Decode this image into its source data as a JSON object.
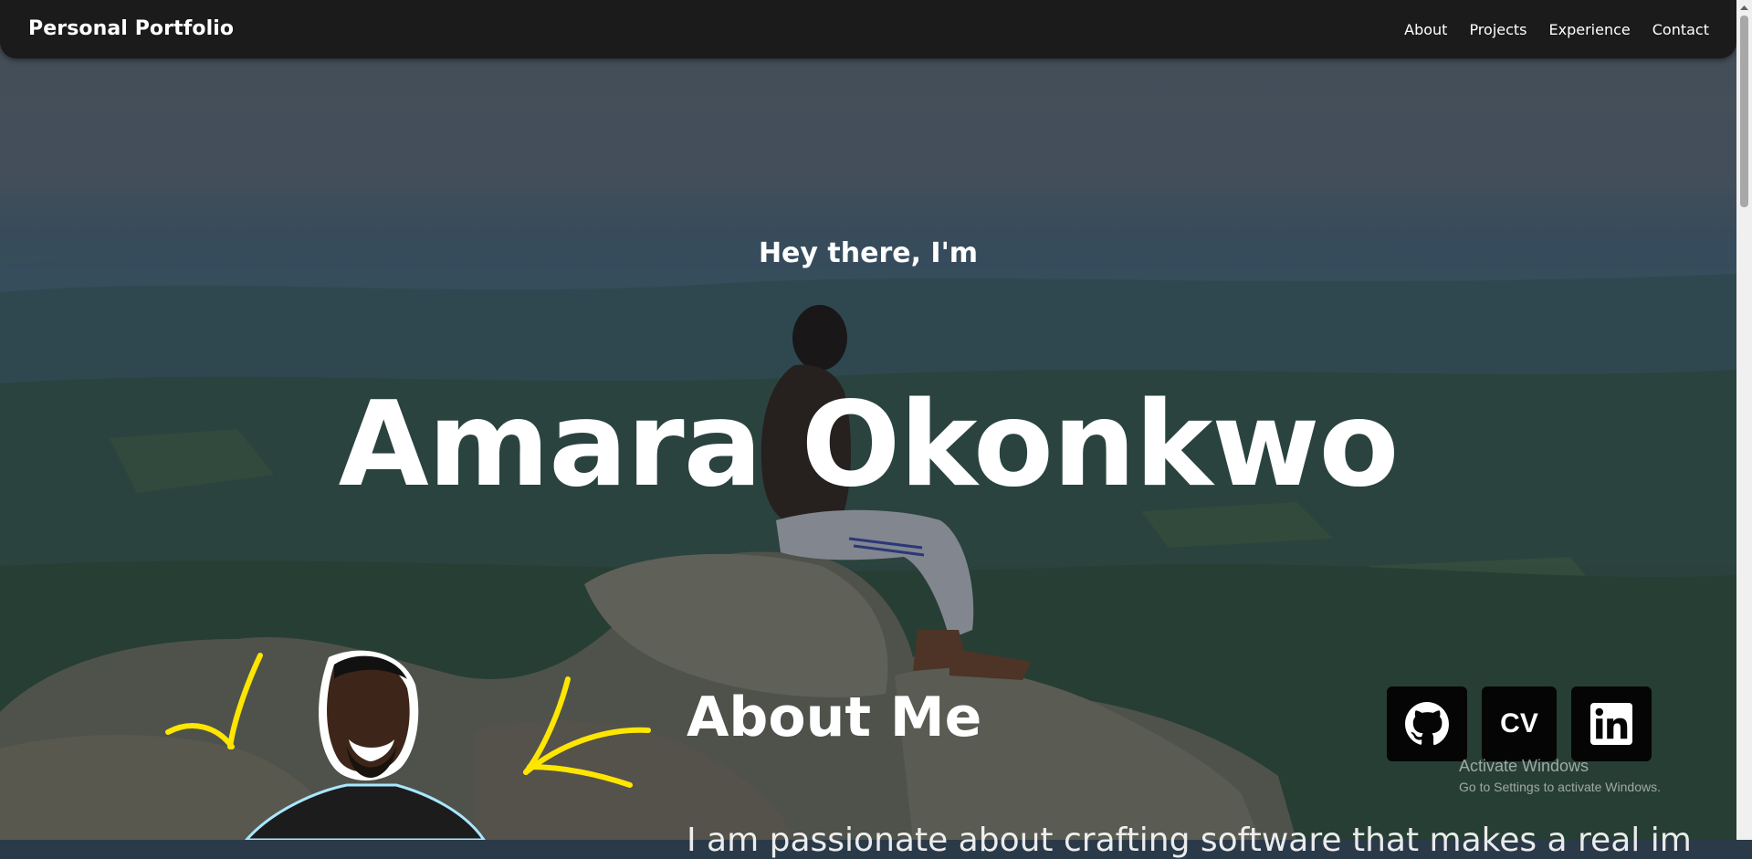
{
  "nav": {
    "brand": "Personal Portfolio",
    "links": [
      "About",
      "Projects",
      "Experience",
      "Contact"
    ]
  },
  "hero": {
    "greeting": "Hey there, I'm",
    "name": "Amara Okonkwo"
  },
  "about": {
    "title": "About Me",
    "text_partial": "I am passionate about crafting software that makes a real impact"
  },
  "socials": {
    "github_icon": "github-icon",
    "cv_label": "CV",
    "linkedin_icon": "linkedin-icon"
  },
  "watermark": {
    "line1": "Activate Windows",
    "line2": "Go to Settings to activate Windows."
  },
  "colors": {
    "nav_bg": "#1b1b1b",
    "text": "#ffffff",
    "accent_arrows": "#ffe600",
    "social_bg": "#050505"
  }
}
